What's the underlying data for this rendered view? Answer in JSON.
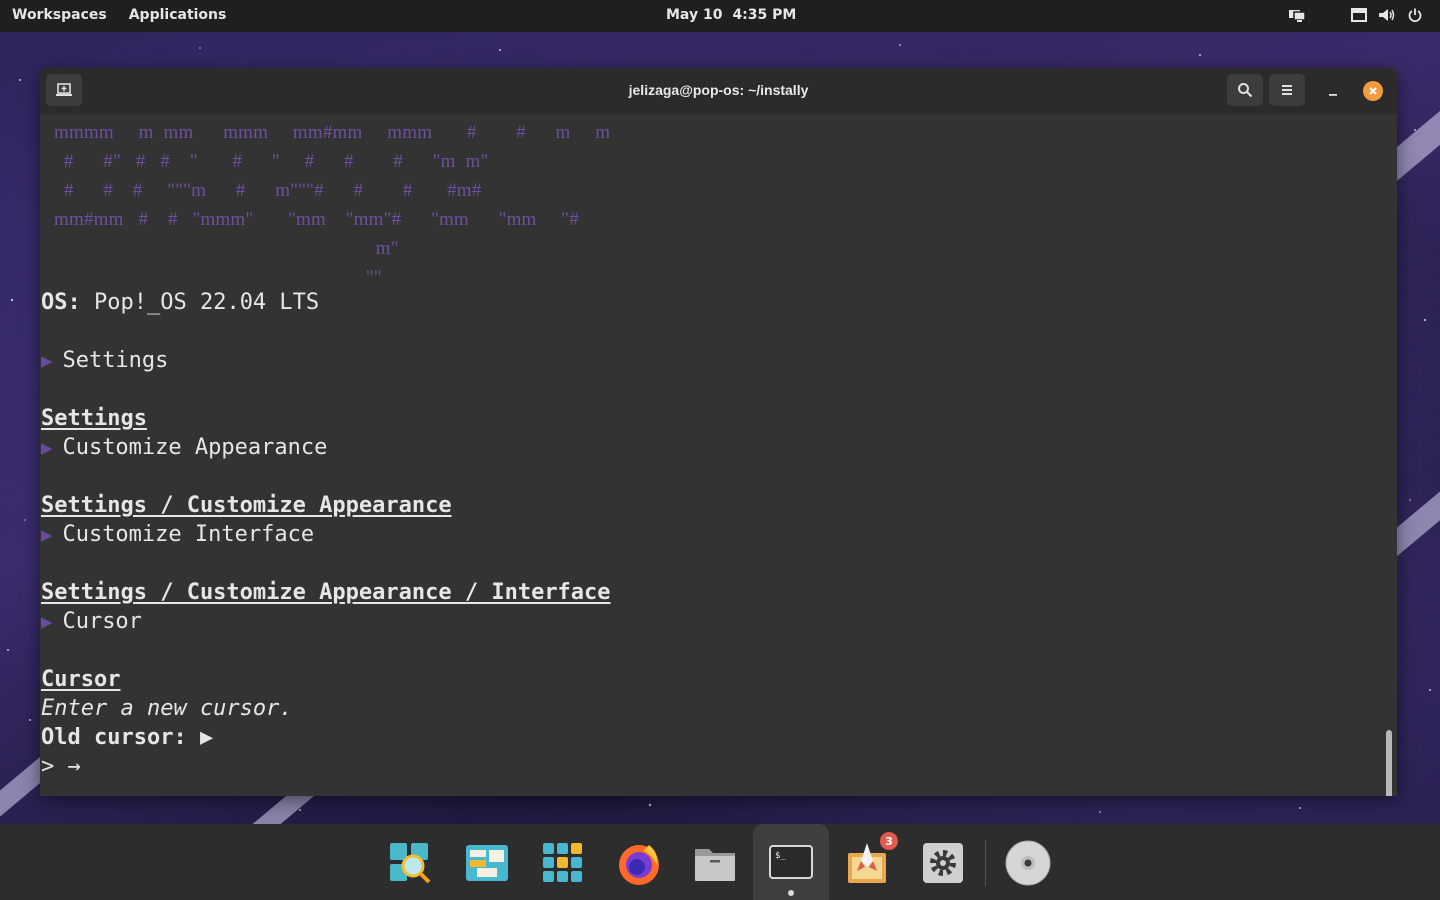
{
  "topbar": {
    "workspaces": "Workspaces",
    "applications": "Applications",
    "date": "May 10",
    "time": "4:35 PM",
    "tray_icons": [
      "display-icon",
      "battery-icon",
      "volume-icon",
      "power-icon"
    ]
  },
  "window": {
    "title": "jelizaga@pop-os: ~/instally"
  },
  "terminal": {
    "ascii_art": [
      "mmmm     m  mm      mmm     mm#mm     mmm       #        #      m     m",
      "  #      #\"   #   #    \"       #      \"     #      #        #      \"m  m\"",
      "  #      #    #     \"\"\"m      #      m\"\"\"#      #        #       #m#",
      "mm#mm   #    #   \"mmm\"       \"mm    \"mm\"#      \"mm      \"mm     \"#",
      "                                                                 m\"",
      "                                                               \"\""
    ],
    "os_label": "OS:",
    "os_value": " Pop!_OS 22.04 LTS",
    "menu1_item": "Settings",
    "heading1": "Settings",
    "menu2_item": "Customize Appearance",
    "heading2": "Settings / Customize Appearance",
    "menu3_item": "Customize Interface",
    "heading3": "Settings / Customize Appearance / Interface",
    "menu4_item": "Cursor",
    "heading4": "Cursor",
    "prompt_hint": "Enter a new cursor.",
    "old_cursor_label": "Old cursor:",
    "old_cursor_value": "▶",
    "input_prompt": ">",
    "input_value": "→",
    "arrow_glyph": "▶"
  },
  "dock": {
    "items": [
      {
        "name": "search-app-icon"
      },
      {
        "name": "workspaces-app-icon"
      },
      {
        "name": "app-grid-icon"
      },
      {
        "name": "firefox-icon"
      },
      {
        "name": "files-icon"
      },
      {
        "name": "terminal-icon",
        "active": true
      },
      {
        "name": "pop-shop-icon",
        "badge": "3"
      },
      {
        "name": "settings-icon"
      },
      {
        "name": "disc-icon"
      }
    ]
  },
  "colors": {
    "accent_purple": "#6e4f9f",
    "close_orange": "#f39c3c",
    "badge_red": "#e05a4e"
  }
}
